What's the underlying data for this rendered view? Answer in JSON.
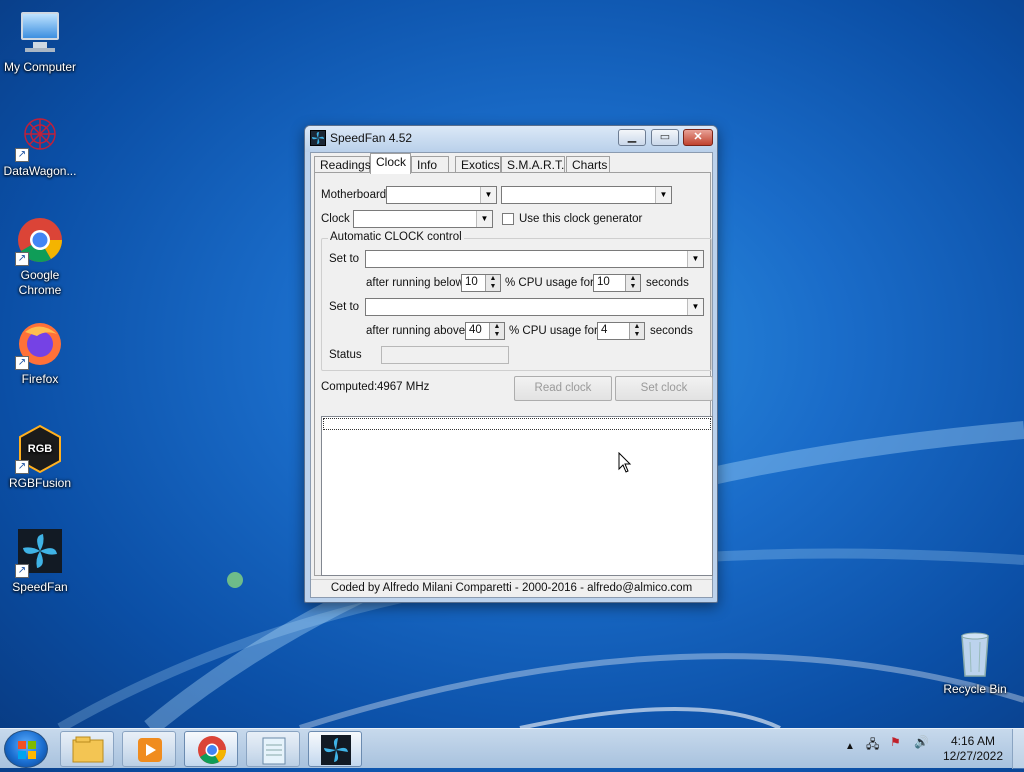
{
  "desktop": {
    "icons": [
      {
        "label": "My Computer",
        "icon": "computer-icon"
      },
      {
        "label": "DataWagon...",
        "icon": "datawagon-icon"
      },
      {
        "label": "Google Chrome",
        "icon": "chrome-icon"
      },
      {
        "label": "Firefox",
        "icon": "firefox-icon"
      },
      {
        "label": "RGBFusion",
        "icon": "rgbfusion-icon"
      },
      {
        "label": "SpeedFan",
        "icon": "speedfan-icon"
      },
      {
        "label": "Recycle Bin",
        "icon": "recycle-bin-icon"
      }
    ]
  },
  "window": {
    "title": "SpeedFan 4.52",
    "tabs": [
      "Readings",
      "Clock",
      "Info",
      "Exotics",
      "S.M.A.R.T.",
      "Charts"
    ],
    "active_tab": "Clock",
    "clock": {
      "motherboard_label": "Motherboard",
      "motherboard_value": "",
      "motherboard_value2": "",
      "clock_label": "Clock",
      "clock_value": "",
      "use_generator_label": "Use this clock generator",
      "auto_group_title": "Automatic CLOCK control",
      "set_to_label": "Set to",
      "row1": {
        "prefix": "after running below",
        "cpu_value": "10",
        "mid": "% CPU usage for",
        "seconds_value": "10",
        "suffix": "seconds"
      },
      "row2": {
        "prefix": "after running above",
        "cpu_value": "40",
        "mid": "% CPU usage for",
        "seconds_value": "4",
        "suffix": "seconds"
      },
      "status_label": "Status",
      "computed_label": "Computed:",
      "computed_value": "4967 MHz",
      "read_clock_label": "Read clock",
      "set_clock_label": "Set clock"
    },
    "footer": "Coded by Alfredo Milani Comparetti - 2000-2016 - alfredo@almico.com"
  },
  "taskbar": {
    "time": "4:16 AM",
    "date": "12/27/2022",
    "pinned": [
      "explorer-icon",
      "media-player-icon",
      "chrome-icon",
      "notepad-icon",
      "speedfan-icon"
    ]
  },
  "colors": {
    "accent": "#1a6cc9",
    "window_frame": "#bcd2ec",
    "panel": "#f0f0f0"
  }
}
